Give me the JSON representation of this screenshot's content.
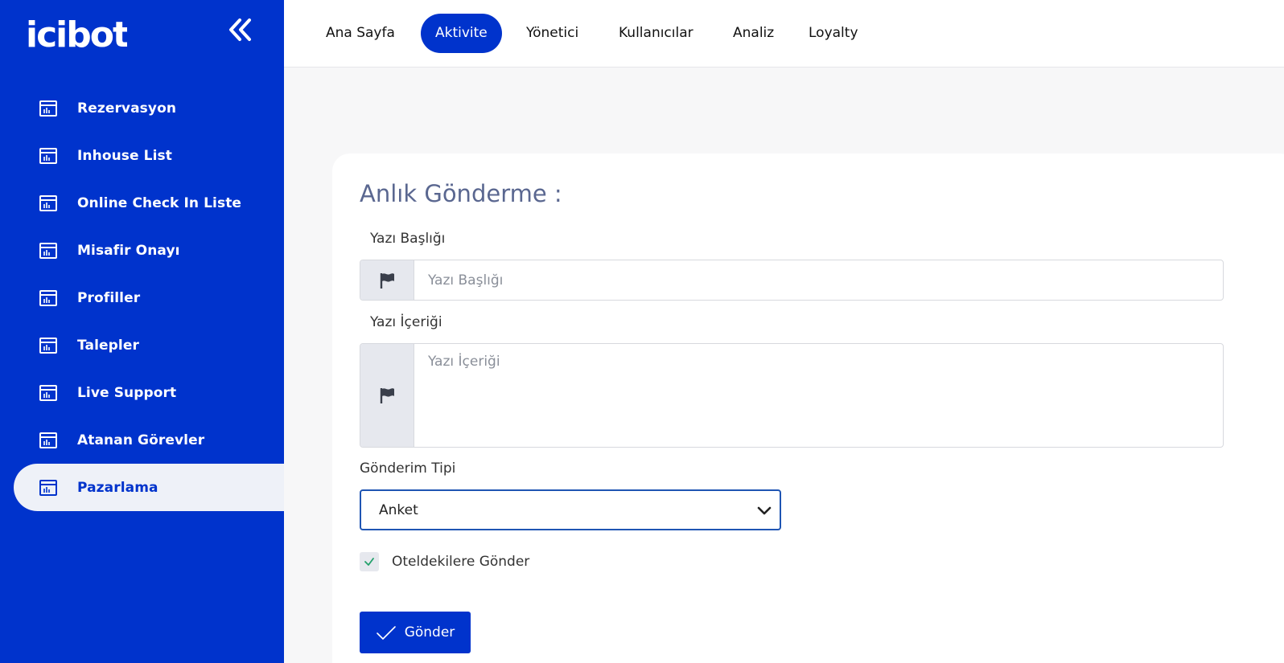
{
  "app": {
    "brand": "icibot",
    "accent": "#0033cc"
  },
  "sidebar": {
    "items": [
      {
        "label": "Rezervasyon",
        "icon": "calendar-chart-icon",
        "active": false
      },
      {
        "label": "Inhouse List",
        "icon": "calendar-chart-icon",
        "active": false
      },
      {
        "label": "Online Check In Liste",
        "icon": "calendar-chart-icon",
        "active": false
      },
      {
        "label": "Misafir Onayı",
        "icon": "calendar-chart-icon",
        "active": false
      },
      {
        "label": "Profiller",
        "icon": "calendar-chart-icon",
        "active": false
      },
      {
        "label": "Talepler",
        "icon": "calendar-chart-icon",
        "active": false
      },
      {
        "label": "Live Support",
        "icon": "calendar-chart-icon",
        "active": false
      },
      {
        "label": "Atanan Görevler",
        "icon": "calendar-chart-icon",
        "active": false
      },
      {
        "label": "Pazarlama",
        "icon": "calendar-chart-icon",
        "active": true
      }
    ]
  },
  "topnav": {
    "tabs": [
      {
        "label": "Ana Sayfa",
        "active": false
      },
      {
        "label": "Aktivite",
        "active": true
      },
      {
        "label": "Yönetici",
        "active": false
      },
      {
        "label": "Kullanıcılar",
        "active": false
      },
      {
        "label": "Analiz",
        "active": false
      },
      {
        "label": "Loyalty",
        "active": false
      }
    ]
  },
  "form": {
    "title": "Anlık Gönderme :",
    "title_field": {
      "label": "Yazı Başlığı",
      "placeholder": "Yazı Başlığı",
      "value": ""
    },
    "content_field": {
      "label": "Yazı İçeriği",
      "placeholder": "Yazı İçeriği",
      "value": ""
    },
    "send_type": {
      "label": "Gönderim Tipi",
      "selected": "Anket"
    },
    "hotel_checkbox": {
      "label": "Oteldekilere Gönder",
      "checked": true
    },
    "submit_label": "Gönder"
  }
}
